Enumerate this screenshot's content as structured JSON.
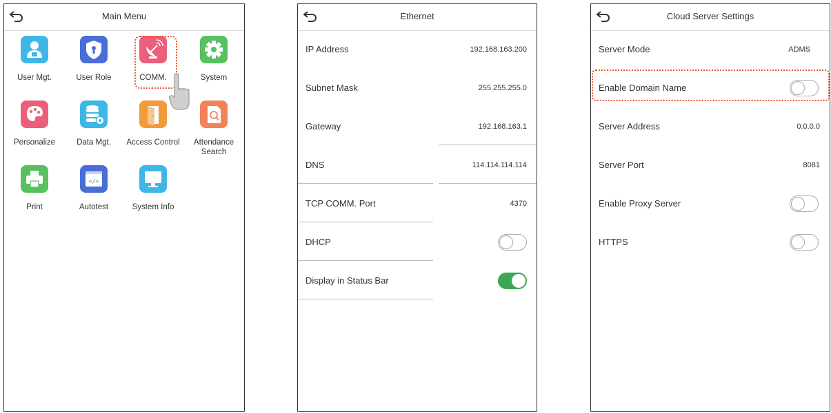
{
  "colors": {
    "highlight": "#e8512e",
    "toggle_on": "#3aa757",
    "border": "#333333"
  },
  "main_menu": {
    "title": "Main Menu",
    "items": [
      {
        "label": "User Mgt.",
        "icon": "user-icon",
        "color": "#3fb7e6"
      },
      {
        "label": "User Role",
        "icon": "shield-icon",
        "color": "#4a6ed8"
      },
      {
        "label": "COMM.",
        "icon": "satellite-dish-icon",
        "color": "#ec5f7a"
      },
      {
        "label": "System",
        "icon": "gear-icon",
        "color": "#57c05f"
      },
      {
        "label": "Personalize",
        "icon": "palette-icon",
        "color": "#ec5f7a"
      },
      {
        "label": "Data Mgt.",
        "icon": "database-icon",
        "color": "#3fb7e6"
      },
      {
        "label": "Access Control",
        "icon": "door-icon",
        "color": "#f39a3a"
      },
      {
        "label": "Attendance\nSearch",
        "icon": "search-document-icon",
        "color": "#f2825a"
      },
      {
        "label": "Print",
        "icon": "printer-icon",
        "color": "#57c05f"
      },
      {
        "label": "Autotest",
        "icon": "code-window-icon",
        "color": "#4a6ed8"
      },
      {
        "label": "System Info",
        "icon": "monitor-icon",
        "color": "#3fb7e6"
      }
    ]
  },
  "ethernet": {
    "title": "Ethernet",
    "rows": [
      {
        "label": "IP Address",
        "value": "192.168.163.200"
      },
      {
        "label": "Subnet Mask",
        "value": "255.255.255.0"
      },
      {
        "label": "Gateway",
        "value": "192.168.163.1"
      },
      {
        "label": "DNS",
        "value": "114.114.114.114"
      },
      {
        "label": "TCP COMM. Port",
        "value": "4370"
      },
      {
        "label": "DHCP",
        "toggle": "off"
      },
      {
        "label": "Display in Status Bar",
        "toggle": "on"
      }
    ]
  },
  "cloud": {
    "title": "Cloud Server Settings",
    "rows": [
      {
        "label": "Server Mode",
        "value": "ADMS"
      },
      {
        "label": "Enable Domain Name",
        "toggle": "off"
      },
      {
        "label": "Server Address",
        "value": "0.0.0.0"
      },
      {
        "label": "Server Port",
        "value": "8081"
      },
      {
        "label": "Enable Proxy Server",
        "toggle": "off"
      },
      {
        "label": "HTTPS",
        "toggle": "off"
      }
    ]
  }
}
